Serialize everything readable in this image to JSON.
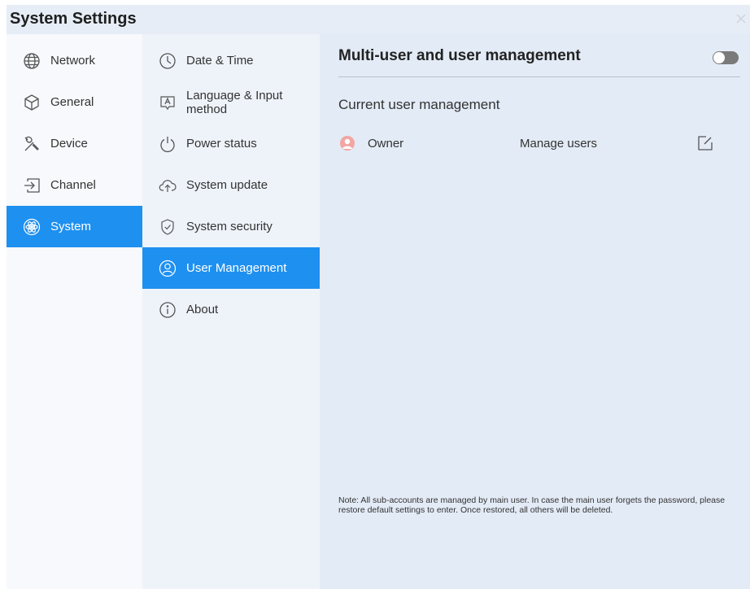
{
  "app": {
    "title": "System Settings"
  },
  "sidebar": {
    "items": [
      {
        "label": "Network",
        "icon": "globe-icon",
        "active": false
      },
      {
        "label": "General",
        "icon": "cube-icon",
        "active": false
      },
      {
        "label": "Device",
        "icon": "tools-icon",
        "active": false
      },
      {
        "label": "Channel",
        "icon": "input-source-icon",
        "active": false
      },
      {
        "label": "System",
        "icon": "atom-icon",
        "active": true
      }
    ]
  },
  "submenu": {
    "items": [
      {
        "label": "Date & Time",
        "icon": "clock-icon",
        "active": false
      },
      {
        "label": "Language & Input\nmethod",
        "icon": "keyboard-letter-icon",
        "active": false
      },
      {
        "label": "Power status",
        "icon": "power-icon",
        "active": false
      },
      {
        "label": "System update",
        "icon": "cloud-upload-icon",
        "active": false
      },
      {
        "label": "System security",
        "icon": "shield-check-icon",
        "active": false
      },
      {
        "label": "User Management",
        "icon": "user-circle-icon",
        "active": true
      },
      {
        "label": "About",
        "icon": "info-icon",
        "active": false
      }
    ]
  },
  "main": {
    "title": "Multi-user and user management",
    "toggle_on": false,
    "current_user_section": "Current user management",
    "user": {
      "name": "Owner",
      "action": "Manage users"
    },
    "note": "Note: All sub-accounts are managed by main user. In case the main user forgets the password, please restore default settings to enter. Once restored, all others will be deleted."
  },
  "colors": {
    "accent": "#1e90f0",
    "avatar": "#f2a6a2"
  }
}
